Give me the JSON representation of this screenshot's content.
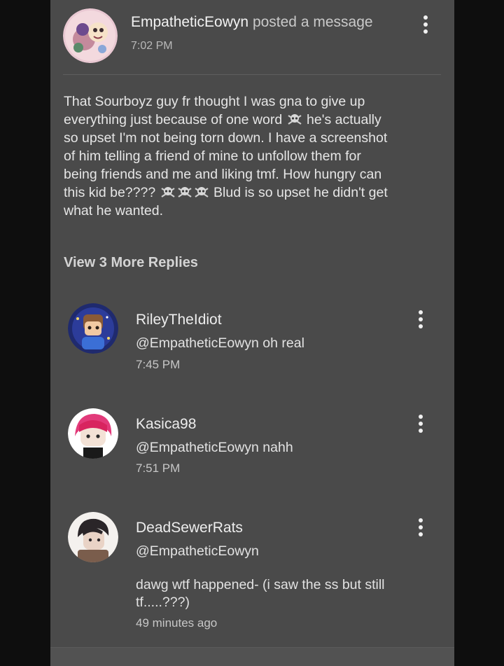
{
  "post": {
    "author": "EmpatheticEowyn",
    "action": "posted a message",
    "time": "7:02 PM",
    "body_lines": [
      "That Sourboyz guy fr thought I was gna to give up",
      "everything just because of one word",
      "he's actually",
      "so upset I'm not being torn down. I have a screenshot",
      "of him telling a friend of mine to unfollow them for",
      "being friends and me and liking tmf. How hungry can",
      "this kid be????",
      "Blud is so upset he didn't get",
      "what he wanted."
    ],
    "skull_icon": "skull-crossbones-icon"
  },
  "view_more_label": "View 3 More Replies",
  "replies": [
    {
      "name": "RileyTheIdiot",
      "text": "@EmpatheticEowyn oh real",
      "time": "7:45 PM"
    },
    {
      "name": "Kasica98",
      "text": "@EmpatheticEowyn nahh",
      "time": "7:51 PM"
    },
    {
      "name": "DeadSewerRats",
      "mention": "@EmpatheticEowyn",
      "text": "dawg wtf happened- (i saw the ss but still tf.....???)",
      "time": "49 minutes ago"
    }
  ],
  "colors": {
    "background": "#0e0e0e",
    "panel": "#4a4a4a",
    "text": "#ececec",
    "muted": "#b9b9b9"
  },
  "icons": {
    "more": "more-vertical-icon"
  }
}
